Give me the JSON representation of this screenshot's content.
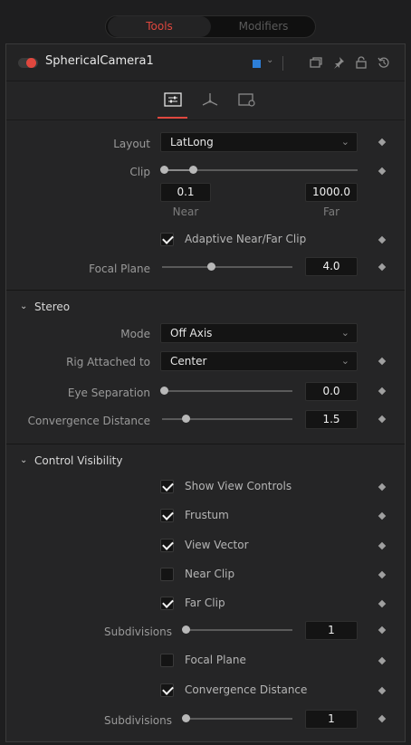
{
  "tabs": {
    "tools": "Tools",
    "modifiers": "Modifiers"
  },
  "header": {
    "tool_name": "SphericalCamera1",
    "color_chip": "#2d7fd8",
    "icons": [
      "chevron-down-icon",
      "window-icon",
      "pin-icon",
      "lock-icon",
      "reset-icon"
    ]
  },
  "icon_tabs": [
    "controls-tab-icon",
    "3d-transform-tab-icon",
    "settings-tab-icon"
  ],
  "controls": {
    "layout": {
      "label": "Layout",
      "value": "LatLong"
    },
    "clip": {
      "label": "Clip",
      "near_value": "0.1",
      "far_value": "1000.0",
      "near_label": "Near",
      "far_label": "Far"
    },
    "adaptive_clip": {
      "label": "Adaptive Near/Far Clip",
      "checked": true
    },
    "focal_plane": {
      "label": "Focal Plane",
      "value": "4.0"
    }
  },
  "stereo": {
    "title": "Stereo",
    "mode": {
      "label": "Mode",
      "value": "Off Axis"
    },
    "rig": {
      "label": "Rig Attached to",
      "value": "Center"
    },
    "eye_separation": {
      "label": "Eye Separation",
      "value": "0.0"
    },
    "convergence": {
      "label": "Convergence Distance",
      "value": "1.5"
    }
  },
  "visibility": {
    "title": "Control Visibility",
    "show_view_controls": {
      "label": "Show View Controls",
      "checked": true
    },
    "frustum": {
      "label": "Frustum",
      "checked": true
    },
    "view_vector": {
      "label": "View Vector",
      "checked": true
    },
    "near_clip": {
      "label": "Near Clip",
      "checked": false
    },
    "far_clip": {
      "label": "Far Clip",
      "checked": true
    },
    "subdivisions_1": {
      "label": "Subdivisions",
      "value": "1"
    },
    "focal_plane": {
      "label": "Focal Plane",
      "checked": false
    },
    "convergence_distance": {
      "label": "Convergence Distance",
      "checked": true
    },
    "subdivisions_2": {
      "label": "Subdivisions",
      "value": "1"
    }
  },
  "colors": {
    "accent": "#e0473e",
    "chip": "#2d7fd8"
  }
}
